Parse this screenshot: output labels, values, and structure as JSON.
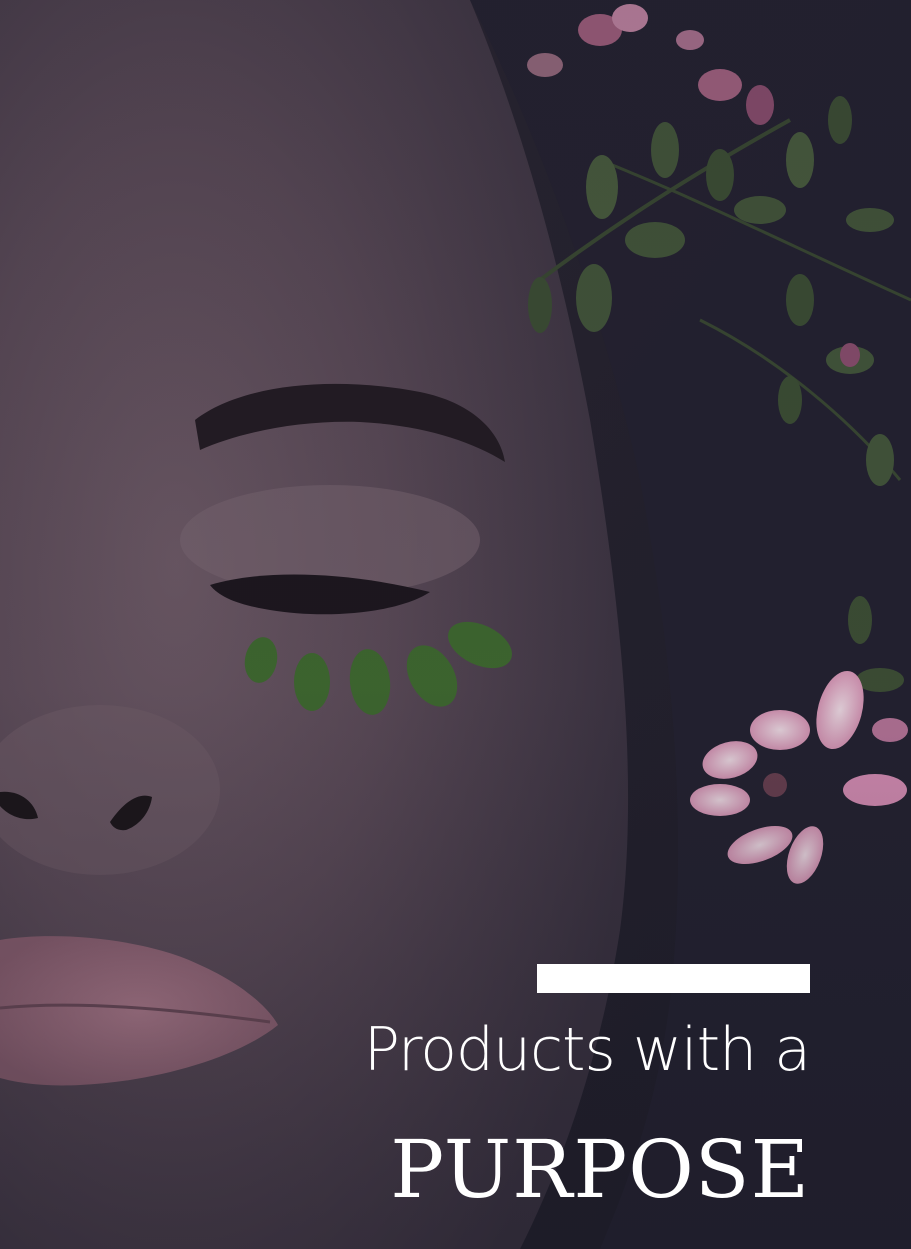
{
  "hero": {
    "image_alt": "Woman with closed eyes, green leaf petals under her eye and pink flowers in her hair",
    "tagline": "Products with a",
    "headline": "PURPOSE"
  },
  "colors": {
    "overlay": "#24222d",
    "text": "#ffffff",
    "accent_bar": "#ffffff",
    "leaf": "#3f6b2f",
    "flower": "#d98fb6"
  }
}
